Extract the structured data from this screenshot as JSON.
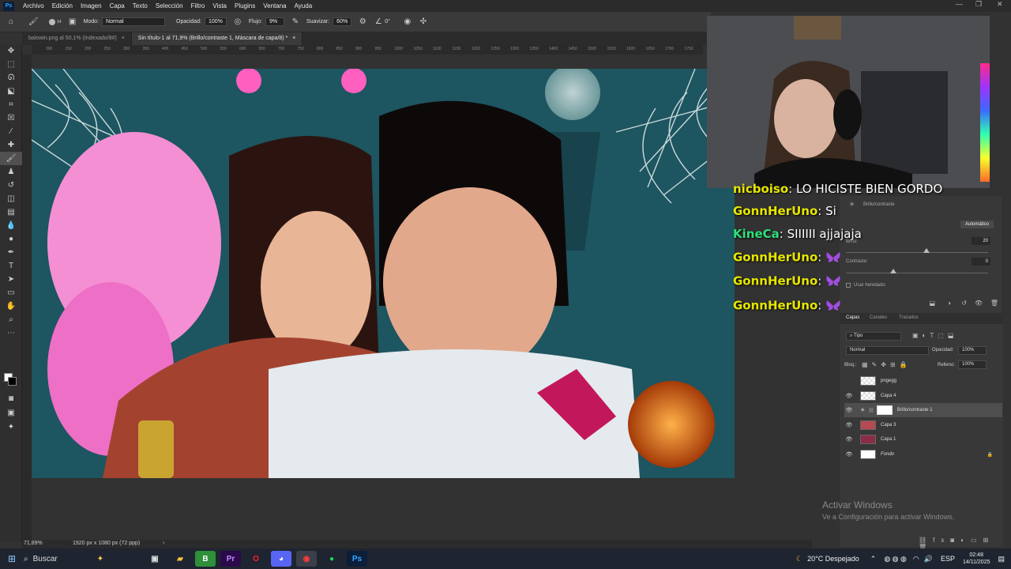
{
  "menubar": {
    "logo": "Ps",
    "items": [
      "Archivo",
      "Edición",
      "Imagen",
      "Capa",
      "Texto",
      "Selección",
      "Filtro",
      "Vista",
      "Plugins",
      "Ventana",
      "Ayuda"
    ]
  },
  "options": {
    "brush_size": "14",
    "mode_label": "Modo:",
    "mode_value": "Normal",
    "opacity_label": "Opacidad:",
    "opacity_value": "100%",
    "flow_label": "Flujo:",
    "flow_value": "9%",
    "smooth_label": "Suavizar:",
    "smooth_value": "60%",
    "angle_value": "0°"
  },
  "tabs": [
    {
      "label": "balowin.png al 50,1% (Indexado/8#)",
      "close": "×"
    },
    {
      "label": "Sin título-1 al 71,9% (Brillo/contraste 1, Máscara de capa/8) *",
      "close": "×"
    }
  ],
  "ruler_ticks": [
    "300",
    "150",
    "200",
    "250",
    "300",
    "350",
    "400",
    "450",
    "500",
    "550",
    "600",
    "650",
    "700",
    "750",
    "800",
    "850",
    "900",
    "950",
    "1000",
    "1050",
    "1100",
    "1150",
    "1200",
    "1250",
    "1300",
    "1350",
    "1400",
    "1450",
    "1500",
    "1550",
    "1600",
    "1650",
    "1700",
    "1750",
    "1800"
  ],
  "status": {
    "zoom": "71,89%",
    "doc_size": "1920 px x 1080 px (72 ppp)"
  },
  "chat": [
    {
      "user": "nicboiso",
      "user_color": "#e6e600",
      "message": "LO HICISTE BIEN GORDO",
      "emote": false
    },
    {
      "user": "GonnHerUno",
      "user_color": "#e6e600",
      "message": "Si",
      "emote": false
    },
    {
      "user": "KineCa",
      "user_color": "#2ee07a",
      "message": "SIIIIII ajjajaja",
      "emote": false
    },
    {
      "user": "GonnHerUno",
      "user_color": "#e6e600",
      "message": "",
      "emote": true
    },
    {
      "user": "GonnHerUno",
      "user_color": "#e6e600",
      "message": "",
      "emote": true
    },
    {
      "user": "GonnHerUno",
      "user_color": "#e6e600",
      "message": "",
      "emote": true
    }
  ],
  "properties": {
    "title": "Brillo/contraste",
    "auto_label": "Automático",
    "brightness_label": "Brillo:",
    "brightness_value": "20",
    "brightness_level": 20,
    "contrast_label": "Contraste:",
    "contrast_value": "0",
    "contrast_level": 0,
    "legacy_label": "Usar heredado"
  },
  "layers_panel": {
    "tabs": [
      "Capas",
      "Canales",
      "Trazados"
    ],
    "filter_value": "Tipo",
    "blend_value": "Normal",
    "opacity_label": "Opacidad:",
    "opacity_value": "100%",
    "lock_label": "Bloq.:",
    "fill_label": "Relleno:",
    "fill_value": "100%",
    "layers": [
      {
        "name": "pngegg",
        "visible": false,
        "selected": false,
        "locked": false
      },
      {
        "name": "Capa 4",
        "visible": true,
        "selected": false,
        "locked": false
      },
      {
        "name": "Brillo/contraste 1",
        "visible": true,
        "selected": true,
        "locked": false
      },
      {
        "name": "Capa 3",
        "visible": true,
        "selected": false,
        "locked": false
      },
      {
        "name": "Capa 1",
        "visible": true,
        "selected": false,
        "locked": false
      },
      {
        "name": "Fondo",
        "visible": true,
        "selected": false,
        "locked": true
      }
    ]
  },
  "activate_windows": {
    "title": "Activar Windows",
    "subtitle": "Ve a Configuración para activar Windows."
  },
  "taskbar": {
    "search_placeholder": "Buscar",
    "weather": "20°C  Despejado",
    "lang": "ESP",
    "time": "02:48",
    "date": "14/11/2025"
  }
}
